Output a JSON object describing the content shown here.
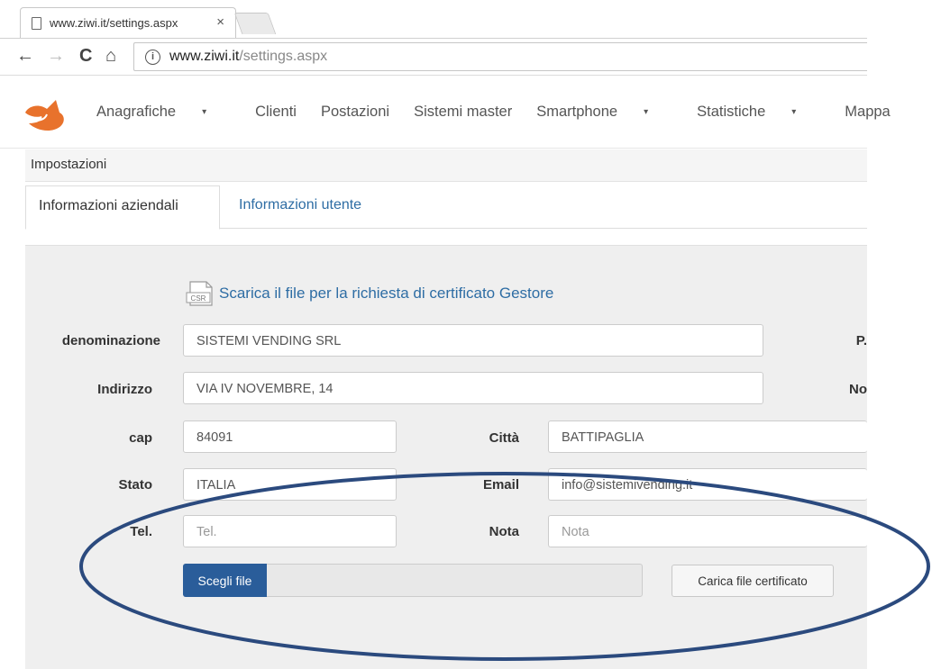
{
  "browser": {
    "tab_title": "www.ziwi.it/settings.aspx",
    "tab_close": "×",
    "nav": {
      "back": "←",
      "forward": "→",
      "reload": "C",
      "home": "⌂"
    },
    "info_glyph": "i",
    "url_host": "www.ziwi.it",
    "url_path": "/settings.aspx"
  },
  "menu": {
    "items": [
      "Anagrafiche",
      "Clienti",
      "Postazioni",
      "Sistemi master",
      "Smartphone",
      "Statistiche",
      "Mappa"
    ]
  },
  "breadcrumb": "Impostazioni",
  "tabs": {
    "active": "Informazioni aziendali",
    "inactive": "Informazioni utente"
  },
  "csr_icon_text": "CSR",
  "csr_link": "Scarica il file per la richiesta di certificato Gestore",
  "form": {
    "denominazione_label": "denominazione",
    "denominazione_value": "SISTEMI VENDING SRL",
    "piva_label_partial": "P.",
    "indirizzo_label": "Indirizzo",
    "indirizzo_value": "VIA IV NOVEMBRE, 14",
    "no_label_partial": "No",
    "cap_label": "cap",
    "cap_value": "84091",
    "citta_label": "Città",
    "citta_value": "BATTIPAGLIA",
    "stato_label": "Stato",
    "stato_value": "ITALIA",
    "email_label": "Email",
    "email_value": "info@sistemivending.it",
    "tel_label": "Tel.",
    "tel_placeholder": "Tel.",
    "nota_label": "Nota",
    "nota_placeholder": "Nota"
  },
  "file_upload": {
    "choose_label": "Scegli file",
    "upload_label": "Carica file certificato"
  },
  "colors": {
    "link": "#2e6da4",
    "file_button": "#2a5d9a",
    "annotation": "#2b4a7e",
    "logo": "#e8722c"
  }
}
